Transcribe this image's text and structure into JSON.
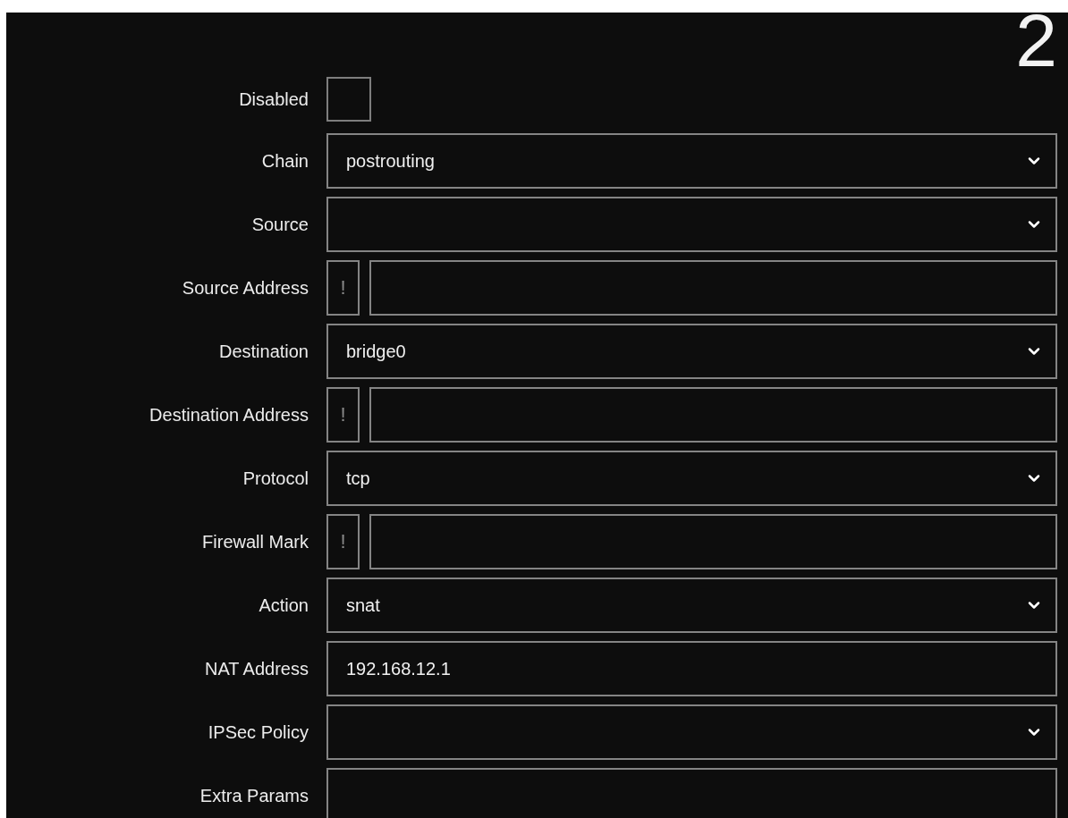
{
  "heading": "2",
  "fields": [
    {
      "kind": "checkbox",
      "label": "Disabled",
      "checked": false
    },
    {
      "kind": "select",
      "label": "Chain",
      "value": "postrouting"
    },
    {
      "kind": "select",
      "label": "Source"
    },
    {
      "kind": "negatable",
      "label": "Source Address",
      "negate": "!",
      "negated": false
    },
    {
      "kind": "select",
      "label": "Destination",
      "value": "bridge0"
    },
    {
      "kind": "negatable",
      "label": "Destination Address",
      "negate": "!",
      "negated": false
    },
    {
      "kind": "select",
      "label": "Protocol",
      "value": "tcp"
    },
    {
      "kind": "negatable",
      "label": "Firewall Mark",
      "negate": "!",
      "negated": false
    },
    {
      "kind": "select",
      "label": "Action",
      "value": "snat"
    },
    {
      "kind": "text",
      "label": "NAT Address",
      "value": "192.168.12.1"
    },
    {
      "kind": "select",
      "label": "IPSec Policy"
    },
    {
      "kind": "text",
      "label": "Extra Params"
    }
  ]
}
